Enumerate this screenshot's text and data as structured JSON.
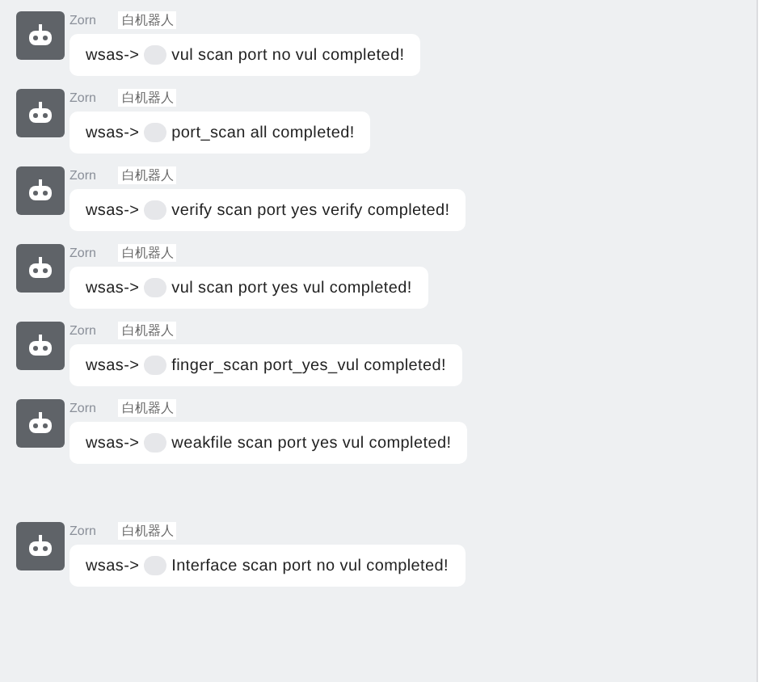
{
  "messages": [
    {
      "sender": "Zorn",
      "tag": "白机器人",
      "prefix": "wsas->",
      "redacted": true,
      "text": "vul scan port no vul completed!"
    },
    {
      "sender": "Zorn",
      "tag": "白机器人",
      "prefix": "wsas->",
      "redacted": true,
      "text": "port_scan all completed!"
    },
    {
      "sender": "Zorn",
      "tag": "白机器人",
      "prefix": "wsas->",
      "redacted": true,
      "text": "verify scan port yes verify completed!"
    },
    {
      "sender": "Zorn",
      "tag": "白机器人",
      "prefix": "wsas->",
      "redacted": true,
      "text": "vul scan port yes vul completed!"
    },
    {
      "sender": "Zorn",
      "tag": "白机器人",
      "prefix": "wsas->",
      "redacted": true,
      "text": "finger_scan port_yes_vul completed!"
    },
    {
      "sender": "Zorn",
      "tag": "白机器人",
      "prefix": "wsas->",
      "redacted": true,
      "text": "weakfile scan port yes vul completed!"
    },
    {
      "sender": "Zorn",
      "tag": "白机器人",
      "prefix": "wsas->",
      "redacted": true,
      "text": "Interface scan port no vul completed!"
    }
  ]
}
